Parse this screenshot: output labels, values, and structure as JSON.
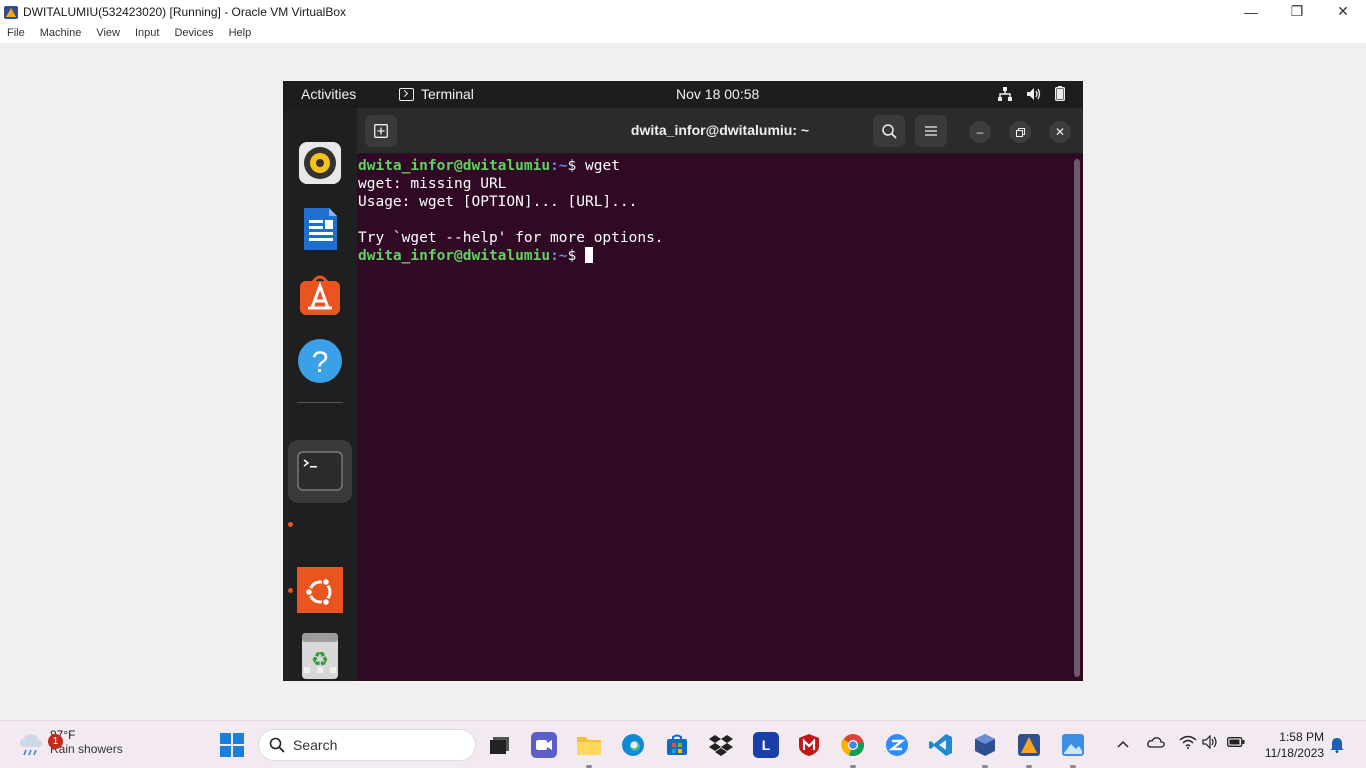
{
  "host": {
    "window_title": "DWITALUMIU(532423020) [Running] - Oracle VM VirtualBox",
    "window_controls": {
      "minimize": "—",
      "restore": "❐",
      "close": "✕"
    },
    "menu": [
      "File",
      "Machine",
      "View",
      "Input",
      "Devices",
      "Help"
    ]
  },
  "guest": {
    "top_bar": {
      "activities": "Activities",
      "app_name": "Terminal",
      "datetime": "Nov 18  00:58"
    },
    "dock": [
      {
        "name": "Rhythmbox",
        "icon": "rhythmbox-icon"
      },
      {
        "name": "LibreOffice Writer",
        "icon": "libreoffice-writer-icon"
      },
      {
        "name": "Ubuntu Software",
        "icon": "ubuntu-software-icon"
      },
      {
        "name": "Help",
        "icon": "help-icon"
      },
      {
        "name": "Terminal",
        "icon": "terminal-icon",
        "running": true,
        "active": true
      },
      {
        "name": "Ubuntu",
        "icon": "ubuntu-icon",
        "running": true
      },
      {
        "name": "Trash",
        "icon": "trash-icon"
      },
      {
        "name": "Show Applications",
        "icon": "app-grid-icon"
      }
    ],
    "terminal": {
      "title": "dwita_infor@dwitalumiu: ~",
      "lines": [
        {
          "user": "dwita_infor@dwitalumiu",
          "path": ":~",
          "symbol": "$ ",
          "cmd": "wget"
        },
        {
          "text": "wget: missing URL"
        },
        {
          "text": "Usage: wget [OPTION]... [URL]..."
        },
        {
          "text": ""
        },
        {
          "text": "Try `wget --help' for more options."
        },
        {
          "user": "dwita_infor@dwitalumiu",
          "path": ":~",
          "symbol": "$ ",
          "cmd": ""
        }
      ]
    }
  },
  "taskbar": {
    "weather": {
      "badge": "1",
      "temp": "87°F",
      "desc": "Rain showers"
    },
    "search_placeholder": "Search",
    "time": "1:58 PM",
    "date": "11/18/2023"
  }
}
